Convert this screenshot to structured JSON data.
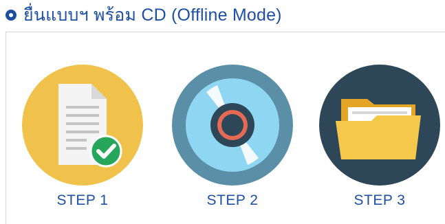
{
  "header": {
    "title": "ยื่นแบบฯ พร้อม CD  (Offline Mode)"
  },
  "steps": [
    {
      "label": "STEP 1",
      "icon": "document-check-icon",
      "bg_color": "#f0c24b"
    },
    {
      "label": "STEP 2",
      "icon": "cd-disc-icon",
      "bg_color": "#5b8fa8"
    },
    {
      "label": "STEP 3",
      "icon": "open-folder-icon",
      "bg_color": "#2d4758"
    }
  ]
}
